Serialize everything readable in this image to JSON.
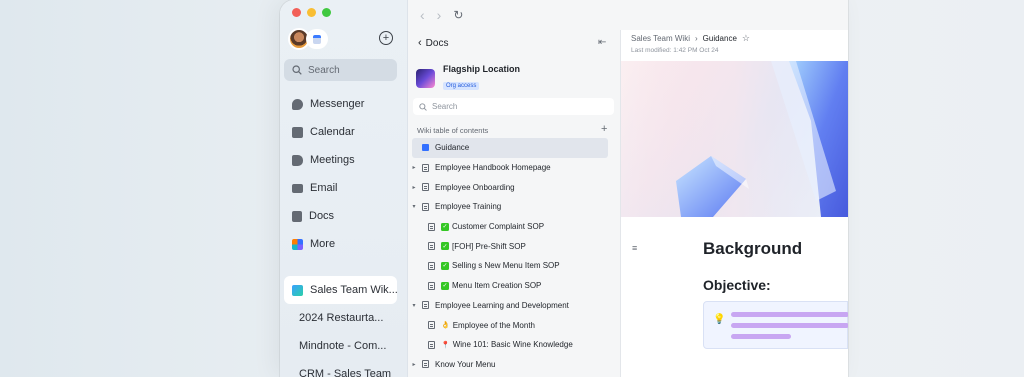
{
  "appnav": {
    "search_placeholder": "Search",
    "items": [
      {
        "label": "Messenger",
        "icon": "messenger-icon",
        "color": "#646a73"
      },
      {
        "label": "Calendar",
        "icon": "calendar-icon",
        "color": "#646a73"
      },
      {
        "label": "Meetings",
        "icon": "video-icon",
        "color": "#646a73"
      },
      {
        "label": "Email",
        "icon": "mail-icon",
        "color": "#646a73"
      },
      {
        "label": "Docs",
        "icon": "docs-icon",
        "color": "#646a73"
      },
      {
        "label": "More",
        "icon": "grid-icon",
        "color": "#646a73"
      }
    ],
    "pinned": [
      {
        "label": "Sales Team Wik...",
        "icon": "wiki-icon",
        "color": "#3aa0ff",
        "active": true
      },
      {
        "label": "2024 Restaurta...",
        "icon": "doc-icon",
        "color": "#3370ff",
        "active": false
      },
      {
        "label": "Mindnote - Com...",
        "icon": "mindnote-icon",
        "color": "#18b4c9",
        "active": false
      },
      {
        "label": "CRM - Sales Team",
        "icon": "base-icon",
        "color": "#7b61ff",
        "active": false
      }
    ]
  },
  "docpanel": {
    "back_label": "Docs",
    "space_title": "Flagship Location",
    "space_badge": "Org access",
    "search_placeholder": "Search",
    "toc_label": "Wiki table of contents",
    "toc": [
      {
        "label": "Guidance",
        "depth": 0,
        "caret": "",
        "icon": "blue",
        "prefix": "",
        "selected": true
      },
      {
        "label": "Employee Handbook Homepage",
        "depth": 0,
        "caret": "▸",
        "icon": "doc",
        "prefix": ""
      },
      {
        "label": "Employee Onboarding",
        "depth": 0,
        "caret": "▸",
        "icon": "doc",
        "prefix": ""
      },
      {
        "label": "Employee Training",
        "depth": 0,
        "caret": "▾",
        "icon": "doc",
        "prefix": ""
      },
      {
        "label": "Customer Complaint SOP",
        "depth": 1,
        "caret": "",
        "icon": "doc",
        "prefix": "check"
      },
      {
        "label": "[FOH] Pre-Shift SOP",
        "depth": 1,
        "caret": "",
        "icon": "doc",
        "prefix": "check"
      },
      {
        "label": "Selling s New Menu Item SOP",
        "depth": 1,
        "caret": "",
        "icon": "doc",
        "prefix": "check"
      },
      {
        "label": "Menu Item Creation SOP",
        "depth": 1,
        "caret": "",
        "icon": "doc",
        "prefix": "check"
      },
      {
        "label": "Employee Learning and Development",
        "depth": 0,
        "caret": "▾",
        "icon": "doc",
        "prefix": ""
      },
      {
        "label": "Employee of the Month",
        "depth": 1,
        "caret": "",
        "icon": "doc",
        "prefix": "👌"
      },
      {
        "label": "Wine 101: Basic Wine Knowledge",
        "depth": 1,
        "caret": "",
        "icon": "doc",
        "prefix": "📍"
      },
      {
        "label": "Know Your Menu",
        "depth": 0,
        "caret": "▸",
        "icon": "doc",
        "prefix": ""
      }
    ]
  },
  "content": {
    "breadcrumb_root": "Sales Team Wiki",
    "breadcrumb_current": "Guidance",
    "last_modified": "Last modified: 1:42 PM Oct 24",
    "heading": "Background",
    "subheading": "Objective:"
  }
}
